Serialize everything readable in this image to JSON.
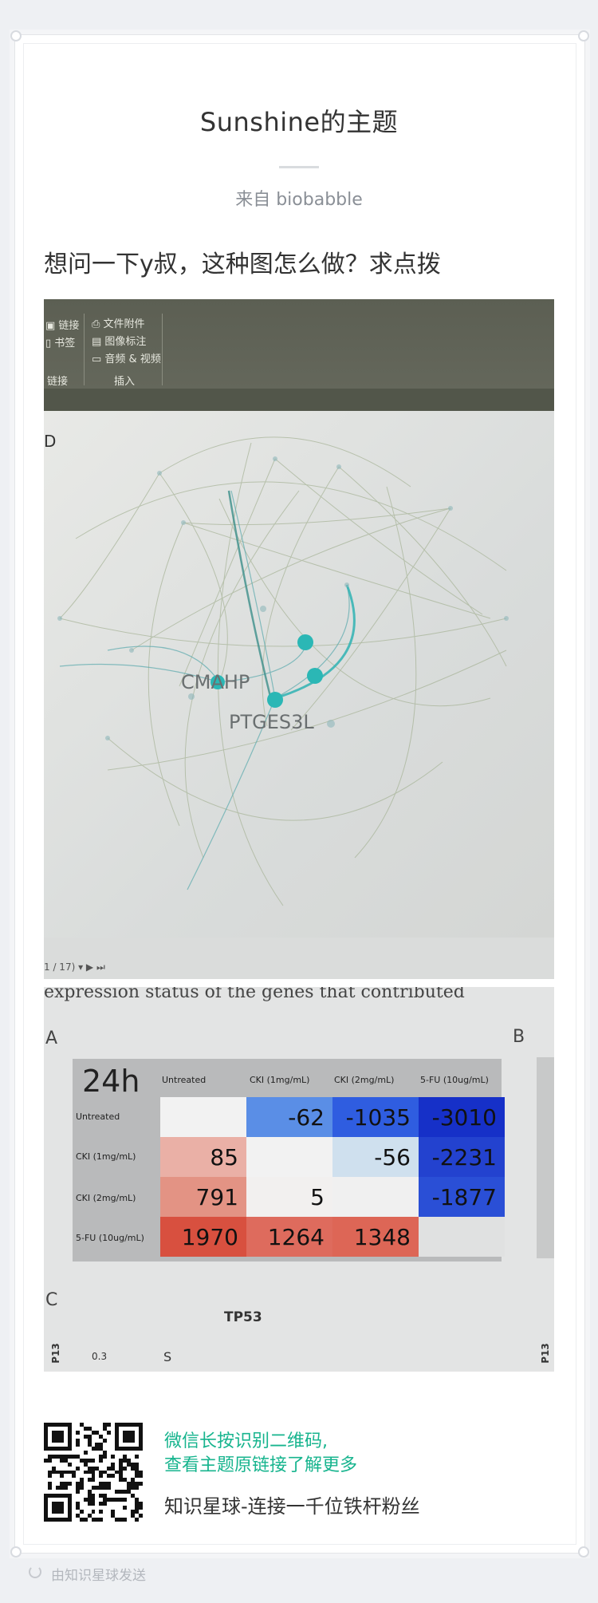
{
  "post": {
    "title": "Sunshine的主题",
    "source": "来自 biobabble",
    "question": "想问一下y叔，这种图怎么做？求点拨"
  },
  "photo1": {
    "toolbar": {
      "link": "链接",
      "bookmark": "书签",
      "group_link": "链接",
      "attachment": "文件附件",
      "image_label": "图像标注",
      "audio_video": "音频 & 视频",
      "group_insert": "插入"
    },
    "panel_letter": "D",
    "page_indicator": "1 / 17)",
    "network_labels": {
      "cmahp": "CMAHP",
      "ptges3l": "PTGES3L"
    }
  },
  "photo2": {
    "cut_text": "expression status of the genes that contributed",
    "letter_a": "A",
    "letter_b": "B",
    "letter_c": "C",
    "heatmap": {
      "time": "24h",
      "columns": [
        "Untreated",
        "CKI (1mg/mL)",
        "CKI (2mg/mL)",
        "5-FU (10ug/mL)"
      ],
      "rows": [
        "Untreated",
        "CKI (1mg/mL)",
        "CKI (2mg/mL)",
        "5-FU (10ug/mL)"
      ],
      "values": [
        [
          "",
          "-62",
          "-1035",
          "-3010"
        ],
        [
          "85",
          "",
          "-56",
          "-2231"
        ],
        [
          "791",
          "5",
          "",
          "-1877"
        ],
        [
          "1970",
          "1264",
          "1348",
          ""
        ]
      ],
      "colors": [
        [
          "#f2f2f2",
          "#5a8ee6",
          "#2f5de0",
          "#1630c8"
        ],
        [
          "#eab0a6",
          "#f2f2f2",
          "#cfe0ee",
          "#2342cf"
        ],
        [
          "#e39384",
          "#f2f0ef",
          "#f0f0f0",
          "#2a4fd6"
        ],
        [
          "#d8503f",
          "#de6b5d",
          "#dd6656",
          "#e0e1e1"
        ]
      ]
    },
    "gene": "TP53",
    "axis_side": "P13",
    "axis_value": "0.3",
    "panel_s": "S",
    "right_side": "P13"
  },
  "footer": {
    "hint_line1": "微信长按识别二维码,",
    "hint_line2": "查看主题原链接了解更多",
    "community": "知识星球-连接一千位铁杆粉丝",
    "sent_via": "由知识星球发送"
  },
  "colors": {
    "accent": "#17b48e",
    "title": "#333333",
    "muted": "#8a8f96"
  }
}
